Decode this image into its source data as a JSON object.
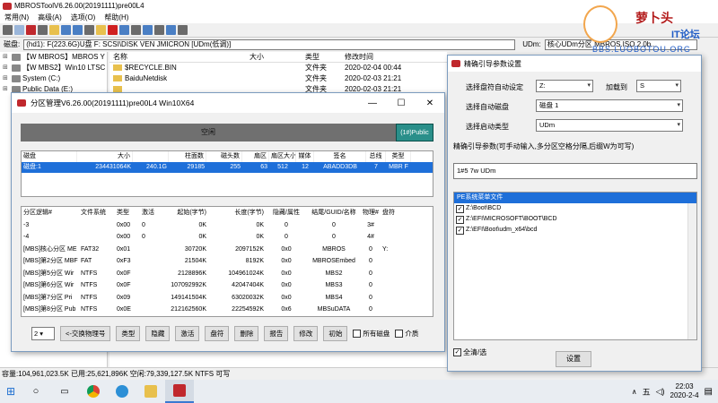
{
  "main": {
    "title": "MBROSToolV6.26.00(20191111)pre00L4",
    "menu": [
      "常用(N)",
      "高级(A)",
      "选项(O)",
      "帮助(H)"
    ],
    "disk_label": "磁盘:",
    "disk_path": "(hd1): F(223.6G)U盘  F: SCSI\\DISK  VEN JMICRON [UDm(低调)]",
    "udm_label": "UDm:",
    "udm_value": "核心UDm分区 MBROS.ISO 2.0b..."
  },
  "tree": [
    {
      "exp": "⊞",
      "label": "【W MBROS】MBROS Y"
    },
    {
      "exp": "⊞",
      "label": "【W MBS2】Win10 LTSC"
    },
    {
      "exp": "⊞",
      "label": "System (C:)"
    },
    {
      "exp": "⊞",
      "label": "Public Data (E:)"
    }
  ],
  "filelist": {
    "headers": [
      "名称",
      "大小",
      "类型",
      "修改时间"
    ],
    "rows": [
      {
        "name": "$RECYCLE.BIN",
        "size": "",
        "type": "文件夹",
        "date": "2020-02-04 00:44"
      },
      {
        "name": "BaiduNetdisk",
        "size": "",
        "type": "文件夹",
        "date": "2020-02-03 21:21"
      },
      {
        "name": "",
        "size": "",
        "type": "文件夹",
        "date": "2020-02-03 21:21"
      }
    ]
  },
  "statusbar": "容量:104,961,023.5K 已用:25,621,896K 空闲:79,339,127.5K NTFS 可写",
  "taskbar": {
    "time": "22:03",
    "date": "2020-2-4",
    "ime": "五"
  },
  "partition_dialog": {
    "title": "分区管理V6.26.00(20191111)pre00L4 Win10X64",
    "free_label": "空闲",
    "pub_label": "(1#)Public",
    "disk_headers": [
      "磁盘",
      "大小",
      "",
      "柱面数",
      "磁头数",
      "扇区",
      "扇区大小",
      "媒体",
      "签名",
      "总线",
      "类型"
    ],
    "disk_row": [
      "磁盘:1",
      "234431064K",
      "240.1G",
      "29185",
      "255",
      "63",
      "512",
      "12",
      "ABADD3DB",
      "7",
      "MBR F"
    ],
    "part_headers": [
      "分区逻辑#",
      "文件系统",
      "类型",
      "激活",
      "起始(字节)",
      "长度(字节)",
      "隐藏/属性",
      "结尾/GUID/名称",
      "物理#",
      "盘符"
    ],
    "part_rows": [
      [
        "-3",
        "",
        "0x00",
        "0",
        "0K",
        "0K",
        "0",
        "0",
        "3#",
        ""
      ],
      [
        "-4",
        "",
        "0x00",
        "0",
        "0K",
        "0K",
        "0",
        "0",
        "4#",
        ""
      ],
      [
        "[MBS]核心分区 ME",
        "FAT32",
        "0x01",
        "",
        "30720K",
        "2097152K",
        "0x0",
        "MBROS",
        "0",
        "Y:"
      ],
      [
        "[MBS]第2分区 MBF",
        "FAT",
        "0xF3",
        "",
        "21504K",
        "8192K",
        "0x0",
        "MBROSEmbed",
        "0",
        ""
      ],
      [
        "[MBS]第5分区 Wir",
        "NTFS",
        "0x0F",
        "",
        "2128896K",
        "104961024K",
        "0x0",
        "MBS2",
        "0",
        ""
      ],
      [
        "[MBS]第6分区 Wir",
        "NTFS",
        "0x0F",
        "",
        "107092992K",
        "42047404K",
        "0x0",
        "MBS3",
        "0",
        ""
      ],
      [
        "[MBS]第7分区 Pri",
        "NTFS",
        "0x09",
        "",
        "149141504K",
        "63020032K",
        "0x0",
        "MBS4",
        "0",
        ""
      ],
      [
        "[MBS]第8分区 Pub",
        "NTFS",
        "0x0E",
        "",
        "212162560K",
        "22254592K",
        "0x6",
        "MBSuDATA",
        "0",
        ""
      ]
    ],
    "select_value": "2",
    "buttons": [
      "<-交换物理号",
      "类型",
      "隐藏",
      "激活",
      "盘符",
      "删除",
      "报告",
      "修改",
      "初始"
    ],
    "chk_all_disks": "所有磁盘",
    "chk_medium": "介质"
  },
  "boot_dialog": {
    "title": "精确引导参数设置",
    "auto_drive_label": "选择盘符自动设定",
    "auto_drive_value": "Z:",
    "load_to_label": "加载到",
    "load_to_value": "S",
    "auto_disk_label": "选择自动磁盘",
    "auto_disk_value": "磁盘 1",
    "auto_type_label": "选择启动类型",
    "auto_type_value": "UDm",
    "params_label": "精确引导参数(可手动输入,多分区空格分隔,后缀W为可写)",
    "params_value": "1#5 7w UDm",
    "menu_header": "PE系统菜单文件",
    "menu_items": [
      "Z:\\Boot\\BCD",
      "Z:\\EFI\\MICROSOFT\\BOOT\\BCD",
      "Z:\\EFI\\Boot\\udm_x64\\bcd"
    ],
    "select_all": "全清/选",
    "set_button": "设置"
  },
  "watermark": {
    "t1": "萝卜头",
    "t2": "IT论坛",
    "t3": "BBS.LUOBOTOU.ORG"
  },
  "colors": {
    "selection": "#1e6fd9",
    "public_part": "#2a8f8a",
    "free_space": "#707070"
  }
}
